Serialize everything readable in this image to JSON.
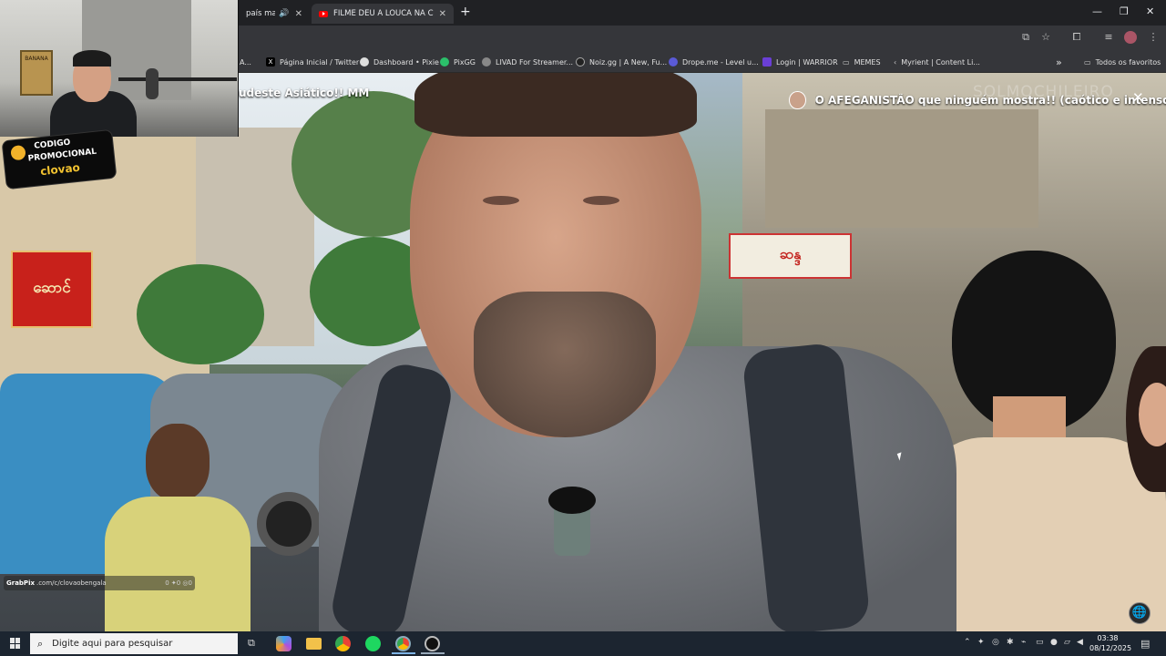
{
  "browser": {
    "tabs": [
      {
        "label": "país mais E"
      },
      {
        "label": "FILME DEU A LOUCA NA CHAR"
      }
    ],
    "new_tab_label": "+",
    "window_controls": {
      "minimize": "—",
      "restore": "❐",
      "close": "✕"
    },
    "bookmarks": [
      {
        "label": "A..."
      },
      {
        "label": "Página Inicial / Twitter"
      },
      {
        "label": "Dashboard • Pixie"
      },
      {
        "label": "PixGG"
      },
      {
        "label": "LIVAD For Streamer..."
      },
      {
        "label": "Noiz.gg | A New, Fu..."
      },
      {
        "label": "Drope.me - Level u..."
      },
      {
        "label": "Login | WARRIOR"
      },
      {
        "label": "MEMES"
      },
      {
        "label": "Myrient | Content Li..."
      }
    ],
    "bookmarks_overflow": "»",
    "all_favorites_label": "Todos os favoritos"
  },
  "video": {
    "title": "O AFEGANISTÃO que ninguém mostra!! (caótico e intenso) AF",
    "watermark": "SOLMOCHILEIRO",
    "subtitle_left": "udeste Asiático!! MM",
    "close_label": "✕",
    "store_sign_left": "ဆောင်",
    "store_sign_right": "ဆန္ဒ",
    "globe_icon": "🌐"
  },
  "webcam": {
    "poster_text": "BANANA",
    "promo_line1": "CODIGO",
    "promo_line2": "PROMOCIONAL",
    "promo_code": "clovao"
  },
  "grabpix": {
    "brand": "GrabPix",
    "url": ".com/c/clovaobengala",
    "stats": "0  ✦0  ◎0"
  },
  "taskbar": {
    "search_placeholder": "Digite aqui para pesquisar",
    "time": "03:38",
    "date": "08/12/2025"
  }
}
